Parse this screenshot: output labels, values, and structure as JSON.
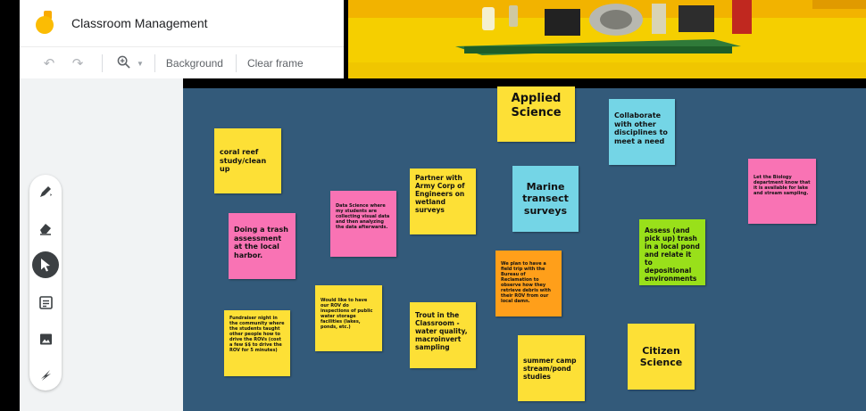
{
  "app": {
    "title": "Classroom Management"
  },
  "toolbar": {
    "background_label": "Background",
    "clear_frame_label": "Clear frame"
  },
  "notes": [
    {
      "text": "Applied Science"
    },
    {
      "text": "coral reef study/clean up"
    },
    {
      "text": "Collaborate with other disciplines to meet a need"
    },
    {
      "text": "Let the Biology department know that it is available for lake and stream sampling."
    },
    {
      "text": "Partner with Army Corp of Engineers on wetland surveys"
    },
    {
      "text": "Marine transect surveys"
    },
    {
      "text": "Data Science where my students are collecting visual data and then analyzing the data afterwards."
    },
    {
      "text": "Doing a trash assessment at the local harbor."
    },
    {
      "text": "Assess (and pick up) trash in a local pond and relate it to depositional environments"
    },
    {
      "text": "We plan to have a field trip with the Bureau of Reclamation to observe how they retrieve debris with their ROV from our local damn."
    },
    {
      "text": "Would like to have our ROV do inspections of public water storage facilities (lakes, ponds, etc.)"
    },
    {
      "text": "Fundraiser night in the community where the students taught other people how to drive the ROVs (cost a few $$ to drive the ROV for 5 minutes)"
    },
    {
      "text": "Trout in the Classroom - water quality, macroinvert sampling"
    },
    {
      "text": "summer camp stream/pond studies"
    },
    {
      "text": "Citizen Science"
    }
  ]
}
